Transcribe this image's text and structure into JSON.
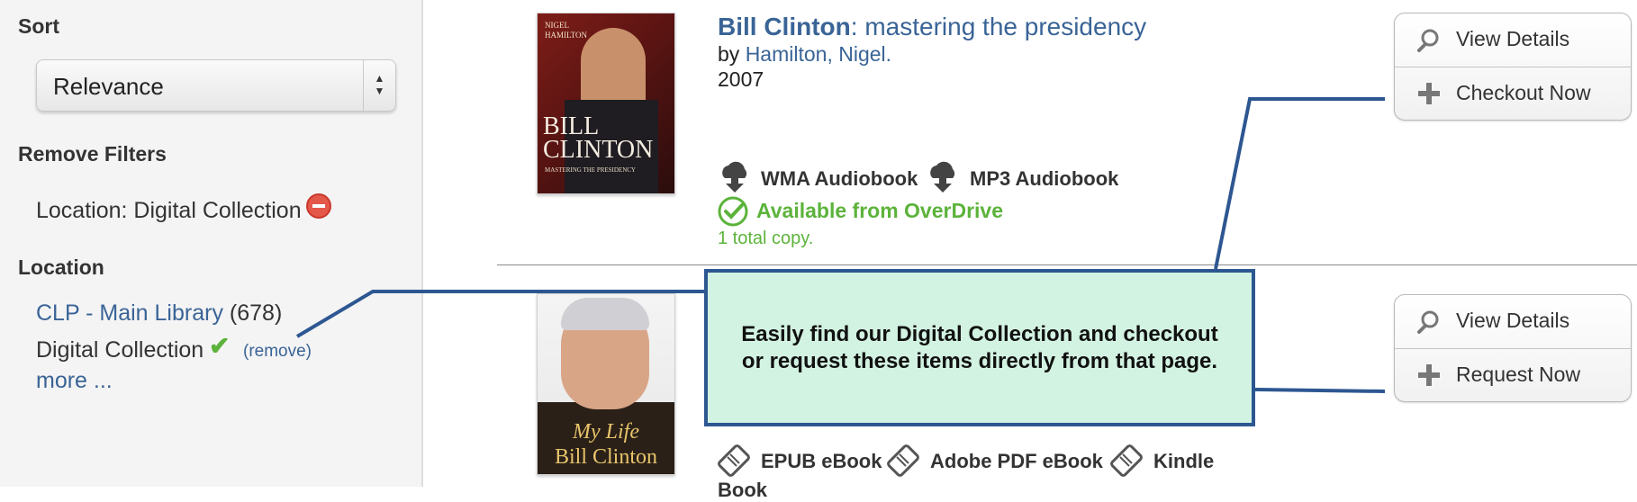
{
  "sidebar": {
    "sort_heading": "Sort",
    "sort_value": "Relevance",
    "remove_filters_heading": "Remove Filters",
    "active_filter": "Location: Digital Collection",
    "location_heading": "Location",
    "locations": [
      {
        "label": "CLP - Main Library",
        "count": "(678)"
      },
      {
        "label": "Digital Collection",
        "remove": "(remove)"
      }
    ],
    "more": "more ..."
  },
  "results": [
    {
      "cover_author": "NIGEL HAMILTON",
      "cover_title_1": "BILL",
      "cover_title_2": "CLINTON",
      "cover_subtitle": "MASTERING THE PRESIDENCY",
      "title_main": "Bill Clinton",
      "title_sub": ": mastering the presidency",
      "by": "by",
      "author": "Hamilton, Nigel.",
      "year": "2007",
      "formats": [
        "WMA Audiobook",
        "MP3 Audiobook"
      ],
      "availability": "Available from OverDrive",
      "copies": "1 total copy.",
      "buttons": [
        "View Details",
        "Checkout Now"
      ]
    },
    {
      "cover_title_1": "My Life",
      "cover_title_2": "Bill Clinton",
      "formats": [
        "EPUB eBook",
        "Adobe PDF eBook",
        "Kindle"
      ],
      "formats_overflow": "Book",
      "buttons": [
        "View Details",
        "Request Now"
      ]
    }
  ],
  "callout": {
    "text": "Easily find our Digital Collection and checkout or request these items directly from that page."
  },
  "colors": {
    "link": "#3a6496",
    "available": "#5cb33b",
    "callout_bg": "#d3f3e2",
    "callout_border": "#2d5791"
  }
}
